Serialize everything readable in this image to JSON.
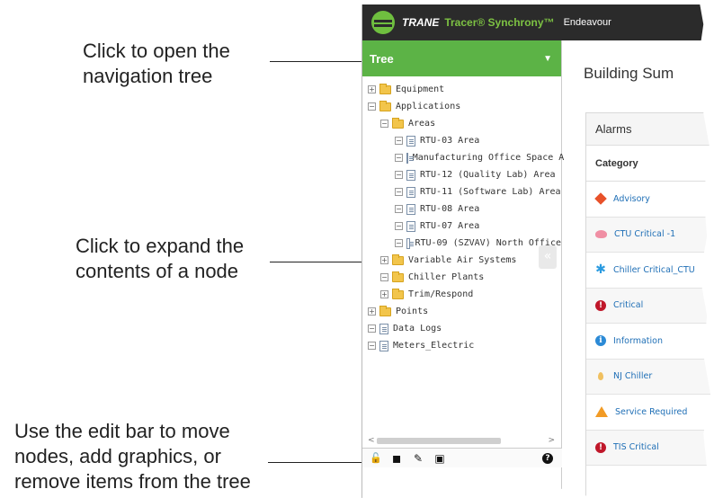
{
  "callouts": {
    "nav_tree": "Click to open the\nnavigation tree",
    "expand_node": "Click to expand the\ncontents of a node",
    "edit_bar": "Use the edit bar to move\nnodes, add graphics, or\nremove items from the tree"
  },
  "app": {
    "brand": "TRANE",
    "product": "Tracer® Synchrony™",
    "site": "Endeavour"
  },
  "tree": {
    "title": "Tree",
    "caret": "▼",
    "nodes": [
      {
        "label": "Equipment",
        "toggle": "+",
        "icon": "folder-icon"
      },
      {
        "label": "Applications",
        "toggle": "−",
        "icon": "open-folder-icon"
      },
      {
        "label": "Areas",
        "toggle": "−",
        "icon": "open-folder-icon"
      },
      {
        "label": "RTU-03 Area",
        "toggle": "−",
        "icon": "document-icon"
      },
      {
        "label": "Manufacturing Office Space A",
        "toggle": "−",
        "icon": "document-icon"
      },
      {
        "label": "RTU-12 (Quality Lab) Area",
        "toggle": "−",
        "icon": "document-icon"
      },
      {
        "label": "RTU-11 (Software Lab) Area",
        "toggle": "−",
        "icon": "document-icon"
      },
      {
        "label": "RTU-08 Area",
        "toggle": "−",
        "icon": "document-icon"
      },
      {
        "label": "RTU-07 Area",
        "toggle": "−",
        "icon": "document-icon"
      },
      {
        "label": "RTU-09 (SZVAV) North Office",
        "toggle": "−",
        "icon": "document-icon"
      },
      {
        "label": "Variable Air Systems",
        "toggle": "+",
        "icon": "folder-icon"
      },
      {
        "label": "Chiller Plants",
        "toggle": "−",
        "icon": "folder-icon"
      },
      {
        "label": "Trim/Respond",
        "toggle": "+",
        "icon": "folder-icon"
      },
      {
        "label": "Points",
        "toggle": "+",
        "icon": "folder-icon"
      },
      {
        "label": "Data Logs",
        "toggle": "−",
        "icon": "document-icon"
      },
      {
        "label": "Meters_Electric",
        "toggle": "−",
        "icon": "document-icon"
      }
    ],
    "scroll_left": "<",
    "scroll_right": ">",
    "editbar": {
      "lock": "🔓",
      "image": "▪",
      "pencil": "✎",
      "add_folder": "▣",
      "help": "?"
    }
  },
  "collapse_tab": "«",
  "main": {
    "title": "Building Sum",
    "alarms_title": "Alarms",
    "category_header": "Category",
    "rows": [
      {
        "label": "Advisory",
        "icon": "advisory-icon"
      },
      {
        "label": "CTU Critical -1",
        "icon": "critical-blob-icon"
      },
      {
        "label": "Chiller Critical_CTU",
        "icon": "snowflake-icon"
      },
      {
        "label": "Critical",
        "icon": "critical-icon"
      },
      {
        "label": "Information",
        "icon": "info-icon"
      },
      {
        "label": "NJ Chiller",
        "icon": "pin-icon"
      },
      {
        "label": "Service Required",
        "icon": "warning-icon"
      },
      {
        "label": "TIS Critical",
        "icon": "critical-icon"
      }
    ]
  },
  "colors": {
    "header_bg": "#2b2b2b",
    "tree_header": "#5cb346",
    "brand_green": "#7dc243",
    "link_blue": "#1f6fb6"
  }
}
